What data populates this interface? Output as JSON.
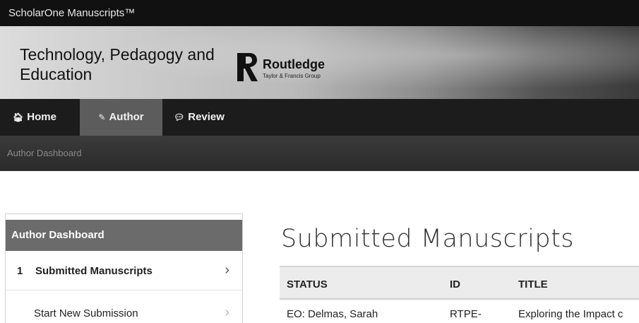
{
  "topbar": {
    "brand": "ScholarOne Manuscripts™"
  },
  "banner": {
    "journal_title": "Technology, Pedagogy and Education",
    "publisher": {
      "name": "Routledge",
      "tagline": "Taylor & Francis Group",
      "icon": "routledge-r-logo"
    }
  },
  "nav": {
    "items": [
      {
        "label": "Home",
        "icon": "home-icon"
      },
      {
        "label": "Author",
        "icon": "pencil-icon",
        "active": true
      },
      {
        "label": "Review",
        "icon": "speech-bubble-icon"
      }
    ]
  },
  "breadcrumb": {
    "text": "Author Dashboard"
  },
  "sidebar": {
    "header": "Author Dashboard",
    "items": [
      {
        "count": "1",
        "label": "Submitted Manuscripts",
        "icon": "chevron-right-icon"
      },
      {
        "label": "Start New Submission",
        "icon": "chevron-right-icon"
      }
    ]
  },
  "main": {
    "title": "Submitted Manuscripts",
    "columns": [
      "STATUS",
      "ID",
      "TITLE"
    ],
    "rows": [
      {
        "status": "EO: Delmas, Sarah",
        "id": "RTPE-",
        "title": "Exploring the Impact c"
      }
    ]
  },
  "colors": {
    "topbar_bg": "#111111",
    "navbar_bg": "#1c1c1c",
    "active_tab_bg": "#5c5c5c",
    "sidebar_header_bg": "#6b6b6b",
    "table_header_bg": "#ececec"
  }
}
